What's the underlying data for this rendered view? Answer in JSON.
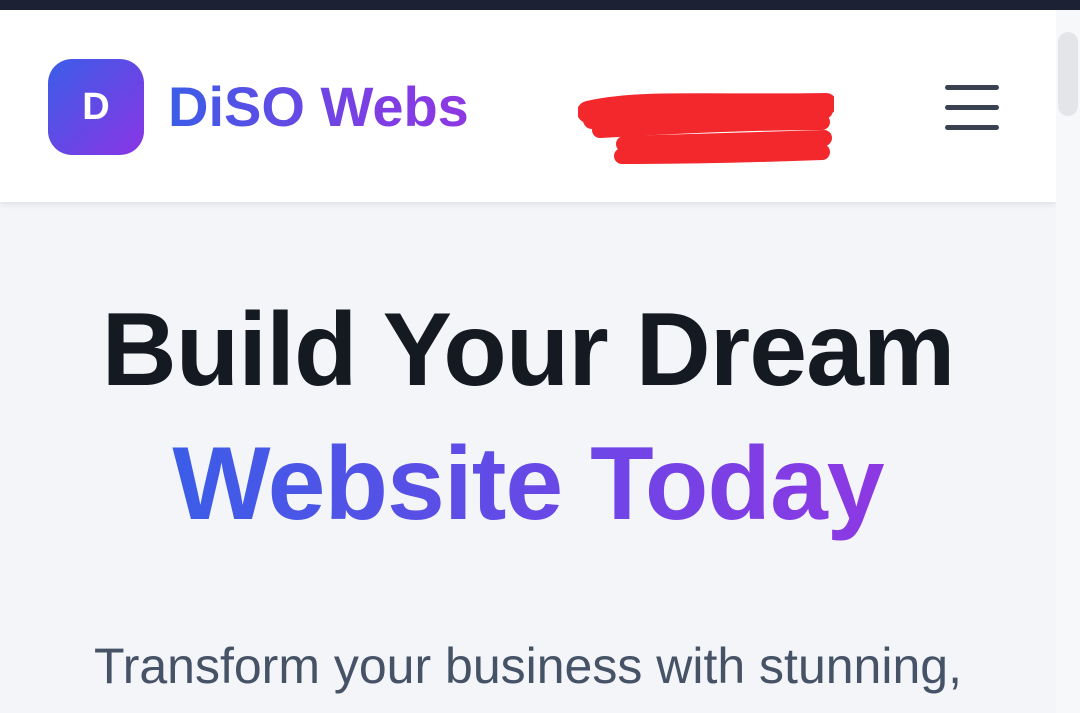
{
  "header": {
    "logo_letter": "D",
    "brand_name": "DiSO Webs",
    "menu_icon": "hamburger-menu-icon"
  },
  "hero": {
    "title_line1": "Build Your Dream",
    "title_line2": "Website Today",
    "subtitle": "Transform your business with stunning,"
  },
  "colors": {
    "brand_gradient_start": "#3b5de7",
    "brand_gradient_end": "#8d38e3",
    "title_text": "#151922",
    "subtitle_text": "#465266",
    "page_background": "#f3f5f9",
    "redaction": "#f2282c"
  }
}
